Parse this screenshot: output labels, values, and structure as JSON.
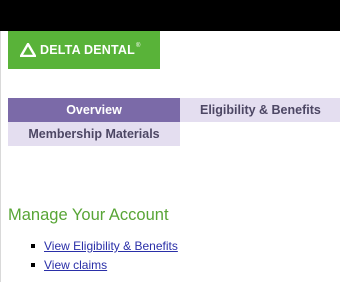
{
  "brand": {
    "logo_text": "DELTA DENTAL",
    "logo_mark": "®",
    "color": "#59b339"
  },
  "nav": {
    "tabs": [
      {
        "label": "Overview",
        "active": true
      },
      {
        "label": "Eligibility & Benefits",
        "active": false
      },
      {
        "label": "Membership Materials",
        "active": false
      }
    ]
  },
  "main": {
    "section_title": "Manage Your Account",
    "links": [
      {
        "label": "View Eligibility & Benefits"
      },
      {
        "label": "View claims"
      }
    ]
  },
  "colors": {
    "tab_active": "#7b6aa8",
    "tab_inactive": "#e4def0",
    "heading": "#58a536",
    "link": "#2a2fa8"
  },
  "icons": {
    "logo": "delta-triangle-icon",
    "bullet": "square-bullet-icon"
  }
}
